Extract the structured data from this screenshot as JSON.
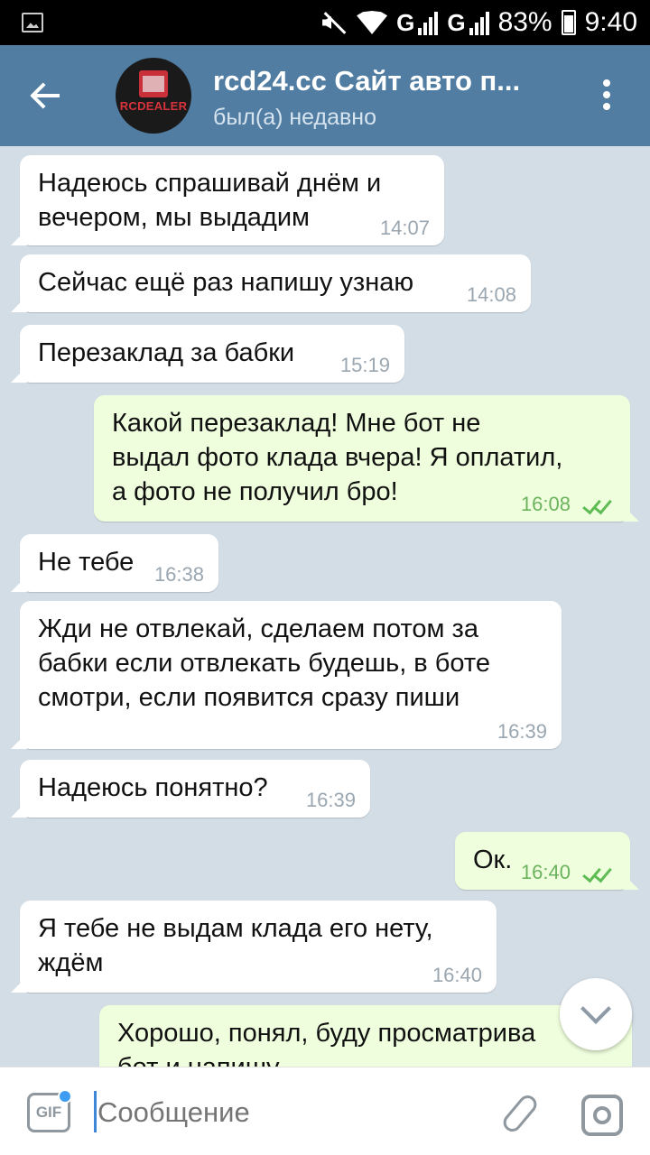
{
  "status_bar": {
    "battery": "83%",
    "time": "9:40",
    "network_1": "G",
    "network_2": "G"
  },
  "header": {
    "title": "rcd24.cc Сайт авто п...",
    "status": "был(а) недавно",
    "avatar_brand": "RCDEALER"
  },
  "messages": [
    {
      "dir": "in",
      "text": "Надеюсь спрашивай днём и\nвечером, мы выдадим",
      "time": "14:07"
    },
    {
      "dir": "in",
      "text": "Сейчас ещё раз напишу узнаю",
      "time": "14:08"
    },
    {
      "dir": "in",
      "text": "Перезаклад за бабки",
      "time": "15:19"
    },
    {
      "dir": "out",
      "text": "Какой перезаклад! Мне бот не\nвыдал фото клада вчера! Я оплатил,\nа фото не получил бро!",
      "time": "16:08"
    },
    {
      "dir": "in",
      "text": "Не тебе",
      "time": "16:38"
    },
    {
      "dir": "in",
      "text": "Жди не отвлекай, сделаем потом за\nбабки если отвлекать будешь, в боте\nсмотри, если появится сразу пиши",
      "time": "16:39"
    },
    {
      "dir": "in",
      "text": "Надеюсь понятно?",
      "time": "16:39"
    },
    {
      "dir": "out",
      "text": "Ок.",
      "time": "16:40"
    },
    {
      "dir": "in",
      "text": "Я тебе не выдам клада его нету,\nждём",
      "time": "16:40"
    },
    {
      "dir": "out",
      "text": "Хорошо, понял, буду просматрива\nбот и напишу",
      "time": ""
    }
  ],
  "input": {
    "placeholder": "Сообщение",
    "gif_label": "GIF"
  },
  "colors": {
    "header": "#517da2",
    "incoming_bubble": "#ffffff",
    "outgoing_bubble": "#effedd",
    "outgoing_time": "#6cb35e",
    "check": "#5fbc54"
  }
}
